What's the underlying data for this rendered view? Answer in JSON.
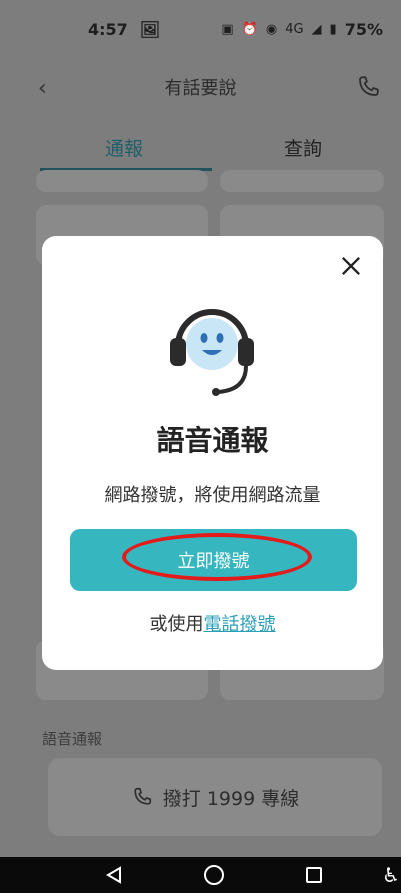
{
  "status_bar": {
    "time": "4:57",
    "network": "4G",
    "battery": "75%"
  },
  "app_bar": {
    "title": "有話要說"
  },
  "tabs": [
    {
      "label": "通報",
      "active": true
    },
    {
      "label": "查詢",
      "active": false
    }
  ],
  "background": {
    "section_label": "語音通報",
    "call_button_label": "撥打 1999 專線"
  },
  "dialog": {
    "title": "語音通報",
    "subtitle": "網路撥號，將使用網路流量",
    "dial_button": "立即撥號",
    "alt_prefix": "或使用",
    "alt_link": "電話撥號"
  },
  "colors": {
    "accent": "#36b7c0",
    "link": "#2a9fb7",
    "tab_active": "#1f5f6a",
    "annotation_circle": "#e31b1b"
  }
}
